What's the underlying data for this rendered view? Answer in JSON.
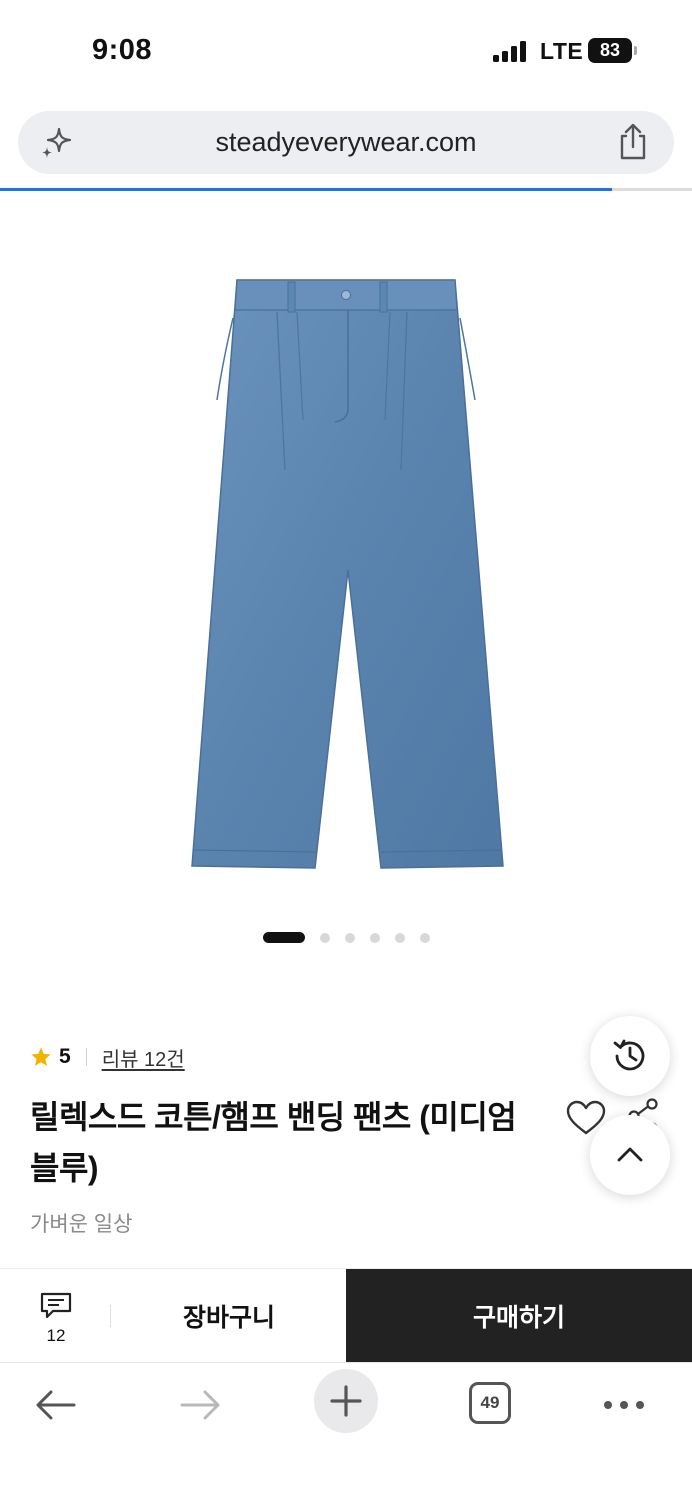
{
  "status_bar": {
    "time": "9:08",
    "network": "LTE",
    "battery": "83"
  },
  "browser": {
    "url": "steadyeverywear.com",
    "load_progress": 0.885,
    "tab_count": "49"
  },
  "gallery": {
    "image_count": 6,
    "active_index": 0
  },
  "product": {
    "rating": "5",
    "review_link": "리뷰 12건",
    "title": "릴렉스드 코튼/햄프 밴딩 팬츠 (미디엄 블루)",
    "brand": "가벼운 일상"
  },
  "purchase_bar": {
    "review_count": "12",
    "cart_label": "장바구니",
    "buy_label": "구매하기"
  },
  "colors": {
    "accent": "#1a73e8",
    "star": "#f5b301",
    "buy_bg": "#222222",
    "denim": "#5d87b3"
  },
  "icons": {
    "url_left": "sparkle-icon",
    "url_right": "share-icon",
    "fab_1": "history-icon",
    "fab_2": "chevron-up-icon",
    "toolbar": [
      "arrow-left-icon",
      "arrow-right-icon",
      "plus-icon",
      "tabs-icon",
      "more-icon"
    ]
  }
}
